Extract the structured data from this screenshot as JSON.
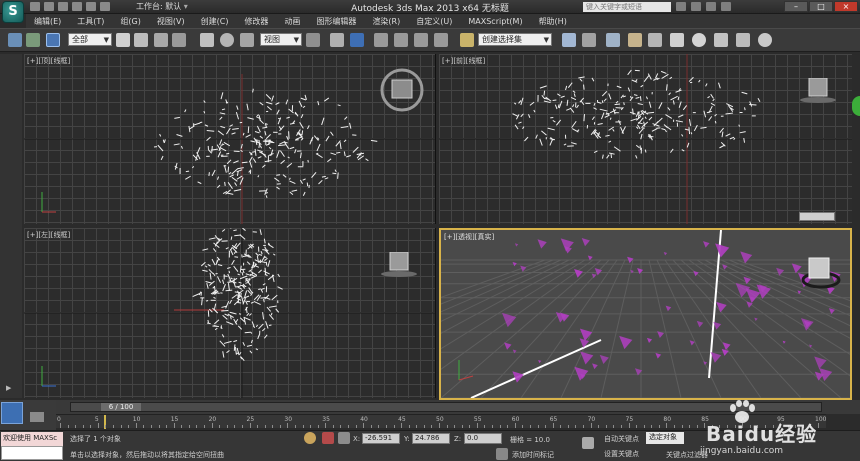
{
  "app": {
    "logo_letter": "S",
    "title": "Autodesk 3ds Max  2013 x64      无标题",
    "workspace_label": "工作台: 默认",
    "search_placeholder": "键入关键字或短语"
  },
  "menu": [
    "编辑(E)",
    "工具(T)",
    "组(G)",
    "视图(V)",
    "创建(C)",
    "修改器",
    "动画",
    "图形编辑器",
    "渲染(R)",
    "自定义(U)",
    "MAXScript(M)",
    "帮助(H)"
  ],
  "toolbar": {
    "filter_value": "全部",
    "reference_coord": "视图",
    "selection_set": "创建选择集"
  },
  "viewports": {
    "top": "[+][顶][线框]",
    "front": "[+][前][线框]",
    "left": "[+][左][线框]",
    "perspective": "[+][透视][真实]"
  },
  "timeline": {
    "frame_display": "6 / 100",
    "ticks": [
      "0",
      "5",
      "10",
      "15",
      "20",
      "25",
      "30",
      "35",
      "40",
      "45",
      "50",
      "55",
      "60",
      "65",
      "70",
      "75",
      "80",
      "85",
      "90",
      "95",
      "100"
    ]
  },
  "status": {
    "maxscript_label": "欢迎使用 MAXSc",
    "selection_text": "选择了 1 个对象",
    "prompt_text": "单击以选择对象，然后拖动以将其指定给空间扭曲",
    "x_label": "X:",
    "x_value": "-26.591",
    "y_label": "Y:",
    "y_value": "24.786",
    "z_label": "Z:",
    "z_value": "0.0",
    "grid_text": "栅格 = 10.0",
    "add_time_tag": "添加时间标记",
    "auto_key": "自动关键点",
    "set_key": "设置关键点",
    "selected_option": "选定对象",
    "key_filters": "关键点过滤器"
  },
  "watermark": {
    "text": "Baidu经验",
    "url": "jingyan.baidu.com"
  },
  "colors": {
    "accent_gold": "#d8b34a",
    "particle_magenta": "#b03fc0",
    "selection_blue": "#3d6fb3"
  }
}
